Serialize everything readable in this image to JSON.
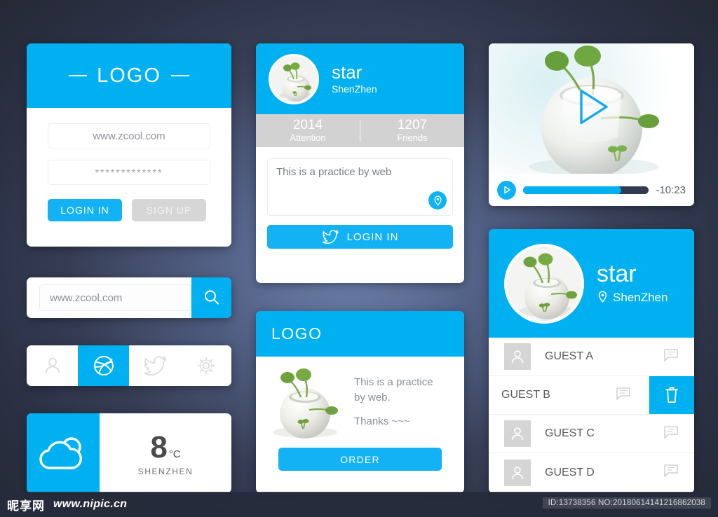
{
  "background": {
    "dark": "#22262f",
    "mid": "#3a4158",
    "glow": "#6b7ba3"
  },
  "theme": {
    "accent": "#00b0f0",
    "accent_button": "#12b2f5",
    "gray_strip": "#d2d2d2",
    "gray_button": "#d6d6d6"
  },
  "login_card": {
    "logo_label": "LOGO",
    "username_value": "www.zcool.com",
    "username_placeholder": "www.zcool.com",
    "password_value": "*************",
    "password_placeholder": "*************",
    "login_button": "LOGIN IN",
    "signup_button": "SIGN UP"
  },
  "search_bar": {
    "value": "www.zcool.com",
    "placeholder": "www.zcool.com",
    "icon": "search-icon"
  },
  "icon_bar": {
    "items": [
      {
        "icon": "user-icon",
        "active": false
      },
      {
        "icon": "dribbble-icon",
        "active": true
      },
      {
        "icon": "twitter-icon",
        "active": false
      },
      {
        "icon": "gear-icon",
        "active": false
      }
    ]
  },
  "weather_card": {
    "icon": "cloud-icon",
    "temperature": "8",
    "unit": "°C",
    "city": "SHENZHEN"
  },
  "profile_card": {
    "avatar": "plant-pot-avatar",
    "name": "star",
    "location": "ShenZhen",
    "stats": [
      {
        "value": "2014",
        "label": "Attention"
      },
      {
        "value": "1207",
        "label": "Friends"
      }
    ],
    "tweet_text": "This is a practice by web",
    "tweet_placeholder": "This is a practice by web",
    "pin_icon": "location-pin-icon",
    "login_button": "LOGIN IN",
    "login_icon": "twitter-icon"
  },
  "order_card": {
    "logo_label": "LOGO",
    "image": "plant-pot-photo",
    "line1": "This is a practice",
    "line2": "by web.",
    "thanks": "Thanks ~~~",
    "order_button": "ORDER"
  },
  "video_card": {
    "poster": "plant-pot-photo",
    "play_overlay_icon": "play-triangle-icon",
    "play_button_icon": "play-icon",
    "progress_percent": 78,
    "time_remaining": "-10:23"
  },
  "guest_card": {
    "avatar": "plant-pot-avatar",
    "name": "star",
    "location": "ShenZhen",
    "location_icon": "location-pin-icon",
    "rows": [
      {
        "name": "GUEST A",
        "swiped": false,
        "chat_icon": "chat-bubble-icon"
      },
      {
        "name": "GUEST B",
        "swiped": true,
        "chat_icon": "chat-bubble-icon",
        "delete_icon": "trash-icon"
      },
      {
        "name": "GUEST C",
        "swiped": false,
        "chat_icon": "chat-bubble-icon"
      },
      {
        "name": "GUEST D",
        "swiped": false,
        "chat_icon": "chat-bubble-icon"
      }
    ]
  },
  "footer": {
    "watermark_glyphs": "昵享网",
    "watermark_url": "www.nipic.cn",
    "id_badge": "ID:13738356 NO:20180614141216862038"
  }
}
